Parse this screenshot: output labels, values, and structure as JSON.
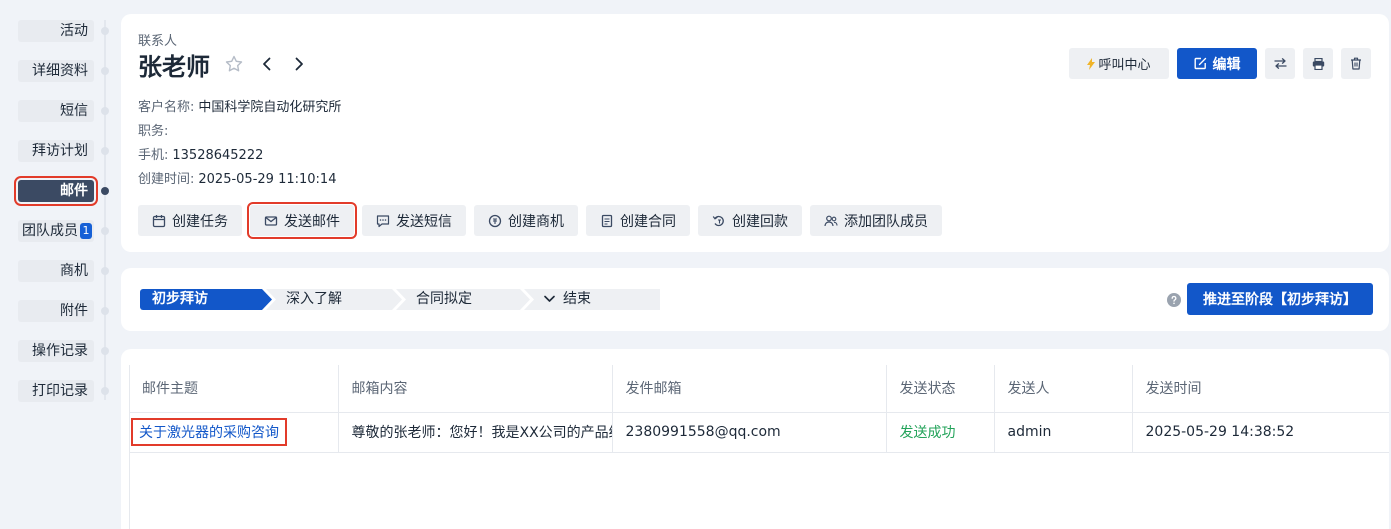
{
  "nav": {
    "items": [
      {
        "label": "活动"
      },
      {
        "label": "详细资料"
      },
      {
        "label": "短信"
      },
      {
        "label": "拜访计划"
      },
      {
        "label": "邮件"
      },
      {
        "label": "团队成员",
        "badge": "1"
      },
      {
        "label": "商机"
      },
      {
        "label": "附件"
      },
      {
        "label": "操作记录"
      },
      {
        "label": "打印记录"
      }
    ],
    "active_index": 4
  },
  "header": {
    "breadcrumb": "联系人",
    "title": "张老师",
    "fields": [
      {
        "label": "客户名称:",
        "value": "中国科学院自动化研究所"
      },
      {
        "label": "职务:",
        "value": ""
      },
      {
        "label": "手机:",
        "value": "13528645222"
      },
      {
        "label": "创建时间:",
        "value": "2025-05-29 11:10:14"
      }
    ],
    "call_center_label": "呼叫中心",
    "edit_label": "编辑"
  },
  "quick_actions": [
    {
      "label": "创建任务",
      "icon": "calendar-icon"
    },
    {
      "label": "发送邮件",
      "icon": "mail-icon"
    },
    {
      "label": "发送短信",
      "icon": "message-icon"
    },
    {
      "label": "创建商机",
      "icon": "coin-icon"
    },
    {
      "label": "创建合同",
      "icon": "document-icon"
    },
    {
      "label": "创建回款",
      "icon": "refund-icon"
    },
    {
      "label": "添加团队成员",
      "icon": "team-icon"
    }
  ],
  "stages": {
    "items": [
      "初步拜访",
      "深入了解",
      "合同拟定",
      "结束"
    ],
    "advance_label": "推进至阶段【初步拜访】"
  },
  "mail_table": {
    "columns": [
      "邮件主题",
      "邮箱内容",
      "发件邮箱",
      "发送状态",
      "发送人",
      "发送时间"
    ],
    "rows": [
      {
        "subject": "关于激光器的采购咨询",
        "content": "尊敬的张老师：您好！我是XX公司的产品经",
        "from": "2380991558@qq.com",
        "status": "发送成功",
        "sender": "admin",
        "time": "2025-05-29 14:38:52"
      }
    ]
  },
  "colors": {
    "primary": "#1257c9",
    "success": "#23a35a",
    "highlight": "#e23b2a",
    "nav_active": "#3b4a63"
  }
}
